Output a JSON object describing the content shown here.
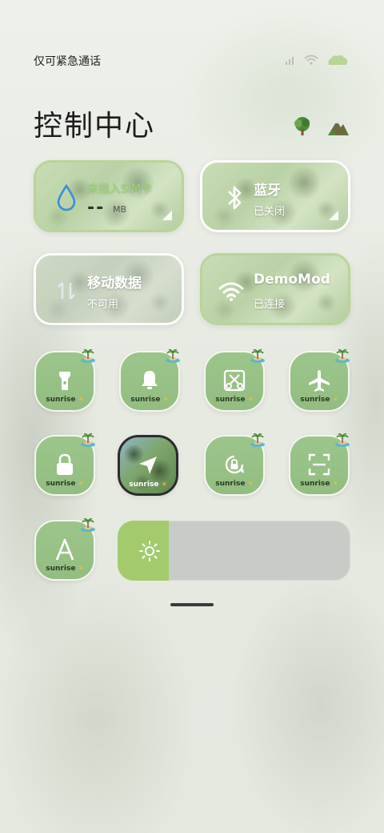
{
  "status_bar": {
    "carrier_text": "仅可紧急通话"
  },
  "header": {
    "title": "控制中心"
  },
  "cards": [
    {
      "id": "data-usage",
      "line1": "未插入SIM卡",
      "line2_value": "--",
      "line2_unit": "MB",
      "active": true
    },
    {
      "id": "bluetooth",
      "line1": "蓝牙",
      "line2": "已关闭",
      "active": false
    },
    {
      "id": "mobile-data",
      "line1": "移动数据",
      "line2": "不可用",
      "active": false
    },
    {
      "id": "wifi",
      "line1": "DemoMod",
      "line2": "已连接",
      "active": true
    }
  ],
  "tiles": [
    {
      "icon": "flashlight-icon",
      "label": "sunrise"
    },
    {
      "icon": "bell-icon",
      "label": "sunrise"
    },
    {
      "icon": "screenshot-scissors-icon",
      "label": "sunrise"
    },
    {
      "icon": "airplane-icon",
      "label": "sunrise"
    },
    {
      "icon": "lock-icon",
      "label": "sunrise"
    },
    {
      "icon": "location-arrow-icon",
      "label": "sunrise"
    },
    {
      "icon": "rotation-lock-icon",
      "label": "sunrise"
    },
    {
      "icon": "scan-icon",
      "label": "sunrise"
    },
    {
      "icon": "font-size-icon",
      "label": "sunrise"
    }
  ],
  "tile_sun_glyph": "☀",
  "brightness": {
    "level_percent": 22
  },
  "colors": {
    "accent_green": "#a3cb6e",
    "tile_green": "#9cc58b",
    "active_border": "#b7d59a"
  }
}
